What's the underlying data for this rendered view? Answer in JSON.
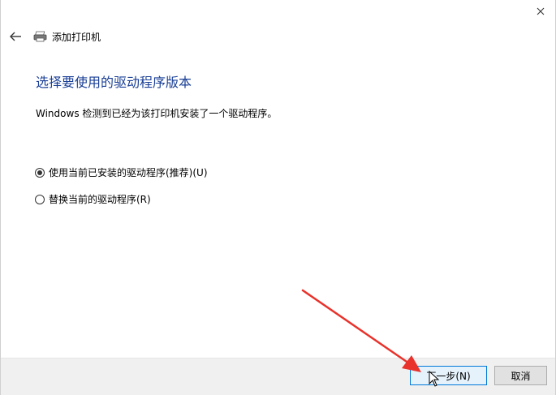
{
  "header": {
    "title": "添加打印机"
  },
  "main": {
    "heading": "选择要使用的驱动程序版本",
    "description": "Windows 检测到已经为该打印机安装了一个驱动程序。",
    "options": [
      {
        "label": "使用当前已安装的驱动程序(推荐)(U)",
        "selected": true
      },
      {
        "label": "替换当前的驱动程序(R)",
        "selected": false
      }
    ]
  },
  "footer": {
    "next_label": "下一步(N)",
    "cancel_label": "取消"
  },
  "icons": {
    "close": "close-icon",
    "back": "back-arrow-icon",
    "printer": "printer-icon",
    "cursor": "mouse-pointer-icon"
  },
  "colors": {
    "heading": "#1a3f96",
    "accent": "#0078d7",
    "annotation": "#e8322b"
  }
}
